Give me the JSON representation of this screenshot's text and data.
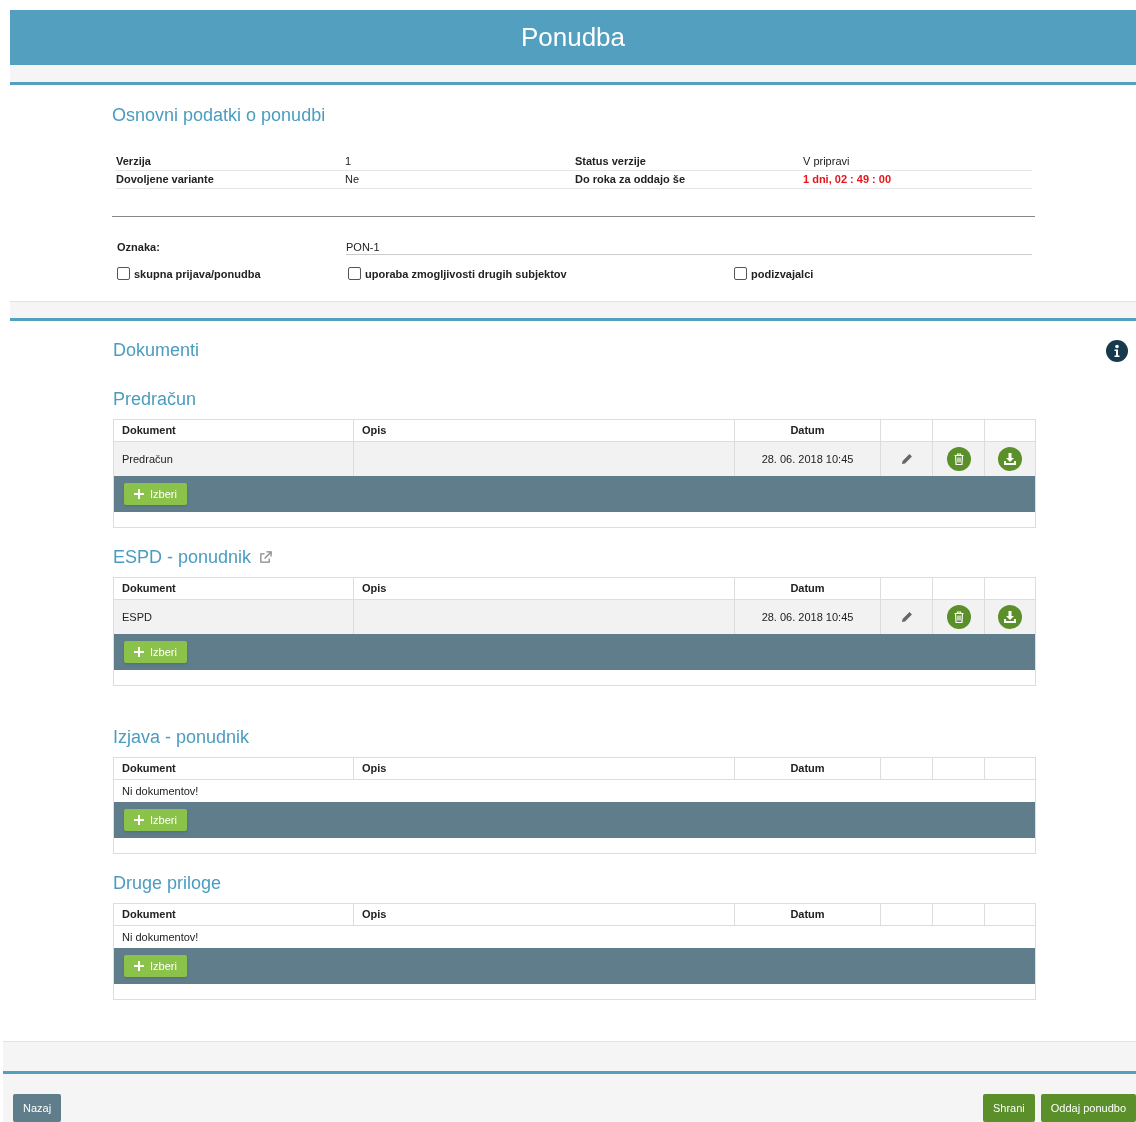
{
  "header": {
    "title": "Ponudba"
  },
  "basic": {
    "heading": "Osnovni podatki o ponudbi",
    "fields": [
      {
        "label": "Verzija",
        "value": "1",
        "kind": "normal"
      },
      {
        "label": "Status verzije",
        "value": "V pripravi",
        "kind": "normal"
      },
      {
        "label": "Dovoljene variante",
        "value": "Ne",
        "kind": "normal"
      },
      {
        "label": "Do roka za oddajo še",
        "value": "1 dni, 02 : 49 : 00",
        "kind": "alert"
      }
    ],
    "oznaka": {
      "label": "Oznaka:",
      "value": "PON-1"
    },
    "checkboxes": [
      {
        "label": "skupna prijava/ponudba",
        "checked": false
      },
      {
        "label": "uporaba zmogljivosti drugih subjektov",
        "checked": false
      },
      {
        "label": "podizvajalci",
        "checked": false
      }
    ]
  },
  "documents": {
    "heading": "Dokumenti",
    "groups": [
      {
        "title": "Predračun",
        "external_link": false,
        "columns": [
          "Dokument",
          "Opis",
          "Datum"
        ],
        "rows": [
          {
            "dokument": "Predračun",
            "datum": "28. 06. 2018 10:45"
          }
        ],
        "add_button": "Izberi"
      },
      {
        "title": "ESPD - ponudnik",
        "external_link": true,
        "columns": [
          "Dokument",
          "Opis",
          "Datum"
        ],
        "rows": [
          {
            "dokument": "ESPD",
            "datum": "28. 06. 2018 10:45"
          }
        ],
        "add_button": "Izberi"
      },
      {
        "title": "Izjava - ponudnik",
        "external_link": false,
        "columns": [
          "Dokument",
          "Opis",
          "Datum"
        ],
        "empty_text": "Ni dokumentov!",
        "add_button": "Izberi"
      },
      {
        "title": "Druge priloge",
        "external_link": false,
        "columns": [
          "Dokument",
          "Opis",
          "Datum"
        ],
        "empty_text": "Ni dokumentov!",
        "add_button": "Izberi"
      }
    ]
  },
  "footer": {
    "buttons": [
      {
        "label": "Nazaj",
        "kind": "back"
      },
      {
        "label": "Shrani",
        "kind": "primary"
      },
      {
        "label": "Oddaj ponudbo",
        "kind": "primary"
      }
    ]
  }
}
